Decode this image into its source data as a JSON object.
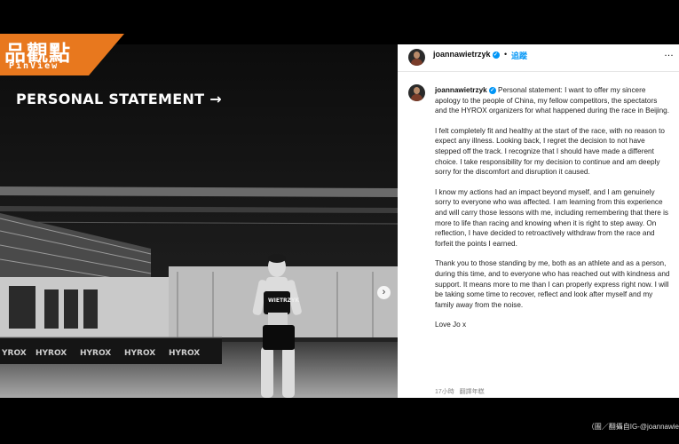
{
  "logo": {
    "main": "品觀點",
    "sub": "PinView"
  },
  "photo": {
    "title": "PERSONAL STATEMENT →"
  },
  "post": {
    "username": "joannawietrzyk",
    "follow_label": "追蹤",
    "separator": "•",
    "more": "…",
    "paragraphs": [
      "Personal statement: I want to offer my sincere apology to the people of China, my fellow competitors, the spectators and the HYROX organizers for what happened during the race in Beijing.",
      "I felt completely fit and healthy at the start of the race, with no reason to expect any illness. Looking back, I regret the decision to not have stepped off the track. I recognize that I should have made a different choice. I take responsibility for my decision to continue and am deeply sorry for the discomfort and disruption it caused.",
      "I know my actions had an impact beyond myself, and I am genuinely sorry to everyone who was affected. I am learning from this experience and will carry those lessons with me, including remembering that there is more to life than racing and knowing when it is right to step away. On reflection, I have decided to retroactively withdraw from the race and forfeit the points I earned.",
      "Thank you to those standing by me, both as an athlete and as a person, during this time, and to everyone who has reached out with kindness and support. It means more to me than I can properly express right now. I will be taking some time to recover, reflect and look after myself and my family away from the noise.",
      "Love Jo x"
    ],
    "time_ago": "17小時",
    "translate_label": "翻譯年糕"
  },
  "credit": "（圖／翻攝自IG-@joannawie",
  "colors": {
    "orange": "#e8781e",
    "link": "#0095f6"
  }
}
